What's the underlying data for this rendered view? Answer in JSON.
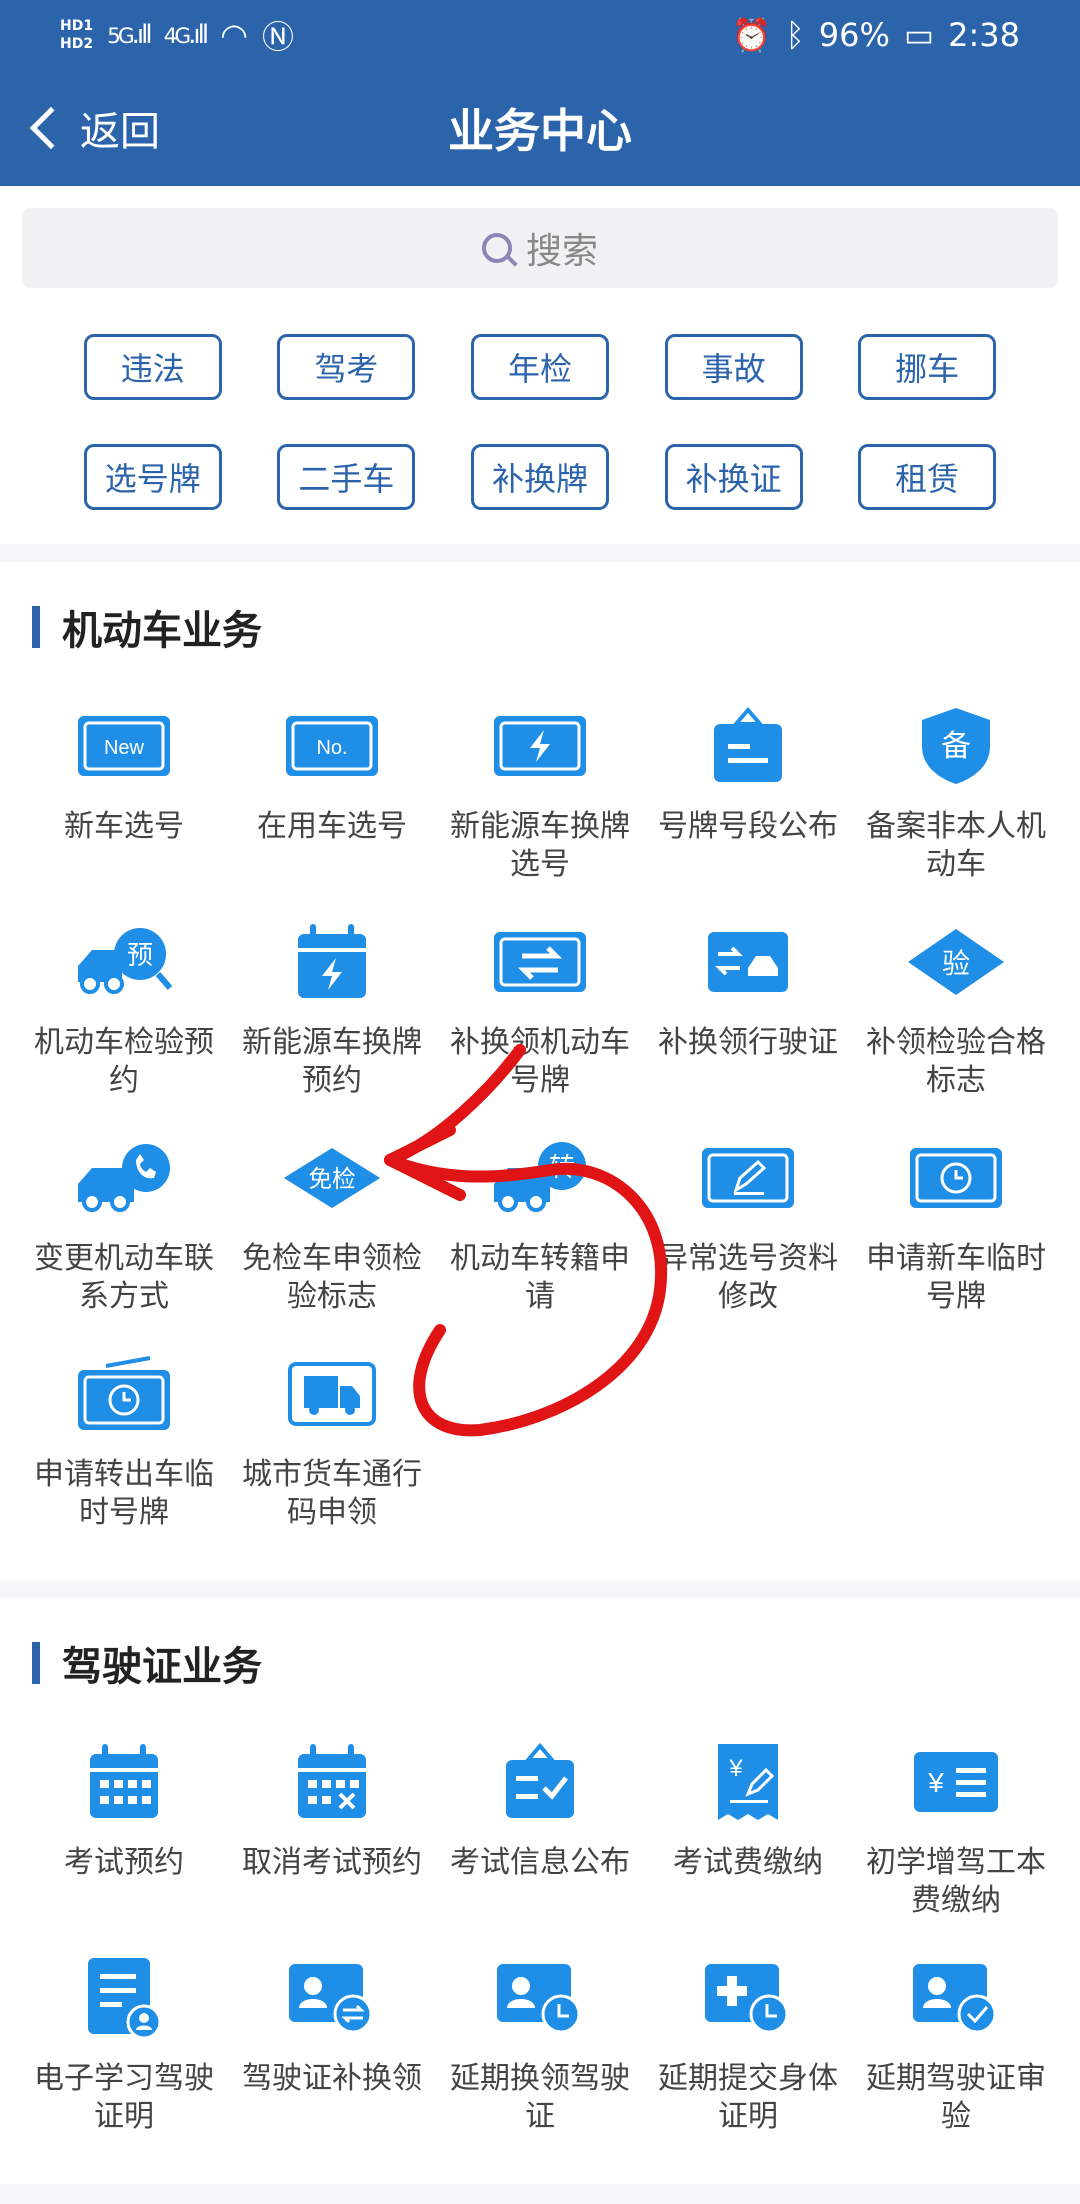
{
  "status": {
    "hd1": "HD1",
    "hd2": "HD2",
    "net1": "5G",
    "net2": "4G",
    "battery": "96%",
    "time": "2:38"
  },
  "nav": {
    "back_label": "返回",
    "title": "业务中心"
  },
  "search": {
    "placeholder": "搜索"
  },
  "quick_chips": [
    "违法",
    "驾考",
    "年检",
    "事故",
    "挪车",
    "选号牌",
    "二手车",
    "补换牌",
    "补换证",
    "租赁"
  ],
  "vehicle_section": {
    "title": "机动车业务",
    "items": [
      {
        "label": "新车选号",
        "icon": "new-plate-icon",
        "badge": "New"
      },
      {
        "label": "在用车选号",
        "icon": "no-plate-icon",
        "badge": "No."
      },
      {
        "label": "新能源车换牌选号",
        "icon": "energy-plate-icon"
      },
      {
        "label": "号牌号段公布",
        "icon": "notice-board-icon"
      },
      {
        "label": "备案非本人机动车",
        "icon": "record-shield-icon",
        "badge": "备"
      },
      {
        "label": "机动车检验预约",
        "icon": "inspection-booking-icon",
        "badge": "预"
      },
      {
        "label": "新能源车换牌预约",
        "icon": "energy-calendar-icon"
      },
      {
        "label": "补换领机动车号牌",
        "icon": "swap-plate-icon"
      },
      {
        "label": "补换领行驶证",
        "icon": "swap-license-icon"
      },
      {
        "label": "补领检验合格标志",
        "icon": "inspection-mark-icon",
        "badge": "验"
      },
      {
        "label": "变更机动车联系方式",
        "icon": "contact-truck-icon"
      },
      {
        "label": "免检车申领检验标志",
        "icon": "exempt-mark-icon",
        "badge": "免检"
      },
      {
        "label": "机动车转籍申请",
        "icon": "transfer-truck-icon",
        "badge": "转"
      },
      {
        "label": "异常选号资料修改",
        "icon": "edit-plate-icon"
      },
      {
        "label": "申请新车临时号牌",
        "icon": "temp-plate-icon"
      },
      {
        "label": "申请转出车临时号牌",
        "icon": "temp-plate-out-icon"
      },
      {
        "label": "城市货车通行码申领",
        "icon": "truck-pass-icon"
      }
    ]
  },
  "license_section": {
    "title": "驾驶证业务",
    "items": [
      {
        "label": "考试预约",
        "icon": "exam-calendar-icon"
      },
      {
        "label": "取消考试预约",
        "icon": "cancel-exam-icon"
      },
      {
        "label": "考试信息公布",
        "icon": "exam-notice-icon"
      },
      {
        "label": "考试费缴纳",
        "icon": "exam-fee-icon"
      },
      {
        "label": "初学增驾工本费缴纳",
        "icon": "fee-list-icon"
      },
      {
        "label": "电子学习驾驶证明",
        "icon": "study-proof-icon"
      },
      {
        "label": "驾驶证补换领",
        "icon": "license-swap-icon"
      },
      {
        "label": "延期换领驾驶证",
        "icon": "delay-renew-icon"
      },
      {
        "label": "延期提交身体证明",
        "icon": "delay-health-icon"
      },
      {
        "label": "延期驾驶证审验",
        "icon": "delay-review-icon"
      }
    ]
  },
  "colors": {
    "primary": "#2c64ac",
    "icon_blue": "#1e8ee6",
    "annotation_red": "#e01414"
  }
}
